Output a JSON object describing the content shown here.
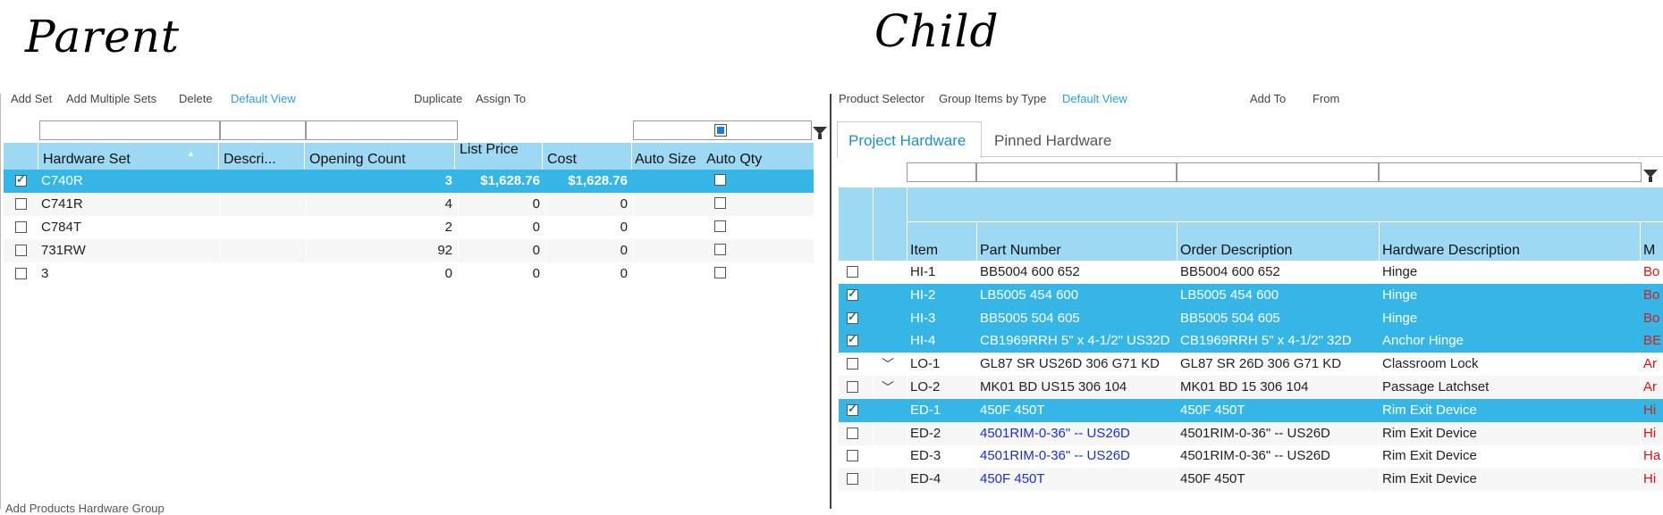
{
  "annotations": {
    "parent": "Parent",
    "child": "Child"
  },
  "parent_toolbar": {
    "add_set": "Add Set",
    "add_multiple_sets": "Add Multiple Sets",
    "delete": "Delete",
    "default_view": "Default View",
    "duplicate": "Duplicate",
    "assign_to": "Assign To"
  },
  "parent_table": {
    "columns": [
      "Hardware Set",
      "Descri...",
      "Opening Count",
      "List Price",
      "Cost",
      "Auto Size",
      "Auto Qty"
    ],
    "rows": [
      {
        "checked": true,
        "set": "C740R",
        "desc": "",
        "count": "3",
        "list": "$1,628.76",
        "cost": "$1,628.76",
        "auto_qty": false,
        "selected": true
      },
      {
        "checked": false,
        "set": "C741R",
        "desc": "",
        "count": "4",
        "list": "0",
        "cost": "0",
        "auto_qty": false,
        "selected": false
      },
      {
        "checked": false,
        "set": "C784T",
        "desc": "",
        "count": "2",
        "list": "0",
        "cost": "0",
        "auto_qty": false,
        "selected": false
      },
      {
        "checked": false,
        "set": "731RW",
        "desc": "",
        "count": "92",
        "list": "0",
        "cost": "0",
        "auto_qty": false,
        "selected": false
      },
      {
        "checked": false,
        "set": "3",
        "desc": "",
        "count": "0",
        "list": "0",
        "cost": "0",
        "auto_qty": false,
        "selected": false
      }
    ]
  },
  "parent_footer": "Add Products   Hardware Group",
  "child_toolbar": {
    "product_selector": "Product Selector",
    "group_items": "Group Items by Type",
    "default_view": "Default View",
    "add_to": "Add To",
    "from": "From"
  },
  "child_tabs": [
    "Project Hardware",
    "Pinned Hardware"
  ],
  "child_table": {
    "columns": [
      "Item",
      "Part Number",
      "Order Description",
      "Hardware Description",
      "M"
    ],
    "rows": [
      {
        "checked": false,
        "expand": false,
        "item": "HI-1",
        "part": "BB5004 600 652",
        "order": "BB5004 600 652",
        "hw": "Hinge",
        "m": "Bo",
        "selected": false,
        "part_link": false
      },
      {
        "checked": true,
        "expand": false,
        "item": "HI-2",
        "part": "LB5005 454 600",
        "order": "LB5005 454 600",
        "hw": "Hinge",
        "m": "Bo",
        "selected": true,
        "part_link": false
      },
      {
        "checked": true,
        "expand": false,
        "item": "HI-3",
        "part": "BB5005 504 605",
        "order": "BB5005 504 605",
        "hw": "Hinge",
        "m": "Bo",
        "selected": true,
        "part_link": false
      },
      {
        "checked": true,
        "expand": false,
        "item": "HI-4",
        "part": "CB1969RRH 5\" x 4-1/2\" US32D",
        "order": "CB1969RRH 5\" x 4-1/2\" 32D",
        "hw": "Anchor Hinge",
        "m": "BE",
        "selected": true,
        "part_link": false
      },
      {
        "checked": false,
        "expand": true,
        "item": "LO-1",
        "part": "GL87 SR US26D 306 G71 KD",
        "order": "GL87 SR 26D 306 G71 KD",
        "hw": "Classroom Lock",
        "m": "Ar",
        "selected": false,
        "part_link": false
      },
      {
        "checked": false,
        "expand": true,
        "item": "LO-2",
        "part": "MK01 BD US15 306 104",
        "order": "MK01 BD 15 306 104",
        "hw": "Passage Latchset",
        "m": "Ar",
        "selected": false,
        "part_link": false
      },
      {
        "checked": true,
        "expand": false,
        "item": "ED-1",
        "part": "450F 450T",
        "order": "450F 450T",
        "hw": "Rim Exit Device",
        "m": "Hi",
        "selected": true,
        "part_link": true
      },
      {
        "checked": false,
        "expand": false,
        "item": "ED-2",
        "part": "4501RIM-0-36\" -- US26D",
        "order": "4501RIM-0-36\" -- US26D",
        "hw": "Rim Exit Device",
        "m": "Hi",
        "selected": false,
        "part_link": true
      },
      {
        "checked": false,
        "expand": false,
        "item": "ED-3",
        "part": "4501RIM-0-36\" -- US26D",
        "order": "4501RIM-0-36\" -- US26D",
        "hw": "Rim Exit Device",
        "m": "Ha",
        "selected": false,
        "part_link": true
      },
      {
        "checked": false,
        "expand": false,
        "item": "ED-4",
        "part": "450F 450T",
        "order": "450F 450T",
        "hw": "Rim Exit Device",
        "m": "Hi",
        "selected": false,
        "part_link": true
      }
    ]
  },
  "colors": {
    "header_bg": "#9dd9f3",
    "selected_bg": "#35b6e6",
    "link": "#2a9fd8",
    "part_link": "#1a2fd6",
    "manufacturer": "#dd1111"
  },
  "icons": {
    "filter": "funnel-icon",
    "sort": "sort-up-icon",
    "expand": "chevron-down-icon"
  }
}
